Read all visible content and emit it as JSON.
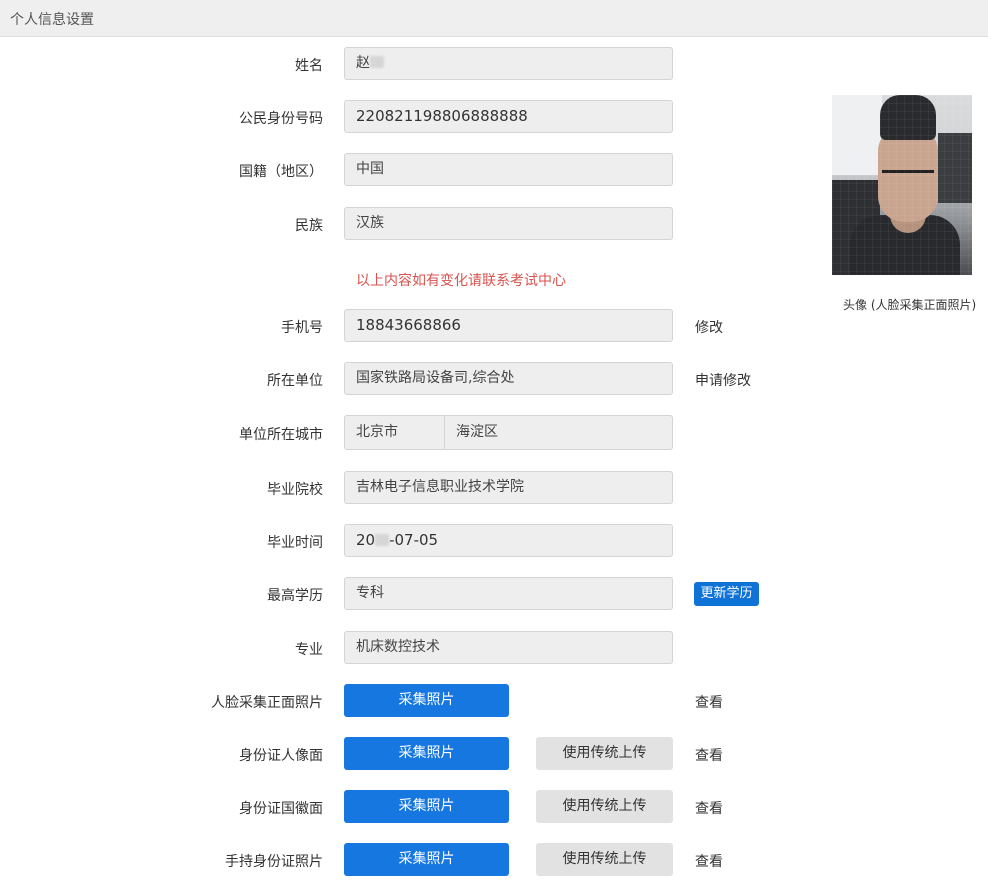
{
  "header": {
    "title": "个人信息设置"
  },
  "form": {
    "name": {
      "label": "姓名",
      "value_prefix": "赵"
    },
    "id_number": {
      "label": "公民身份号码",
      "value": "220821198806888888"
    },
    "nationality": {
      "label": "国籍（地区）",
      "value": "中国"
    },
    "ethnicity": {
      "label": "民族",
      "value": "汉族"
    },
    "notice": "以上内容如有变化请联系考试中心",
    "phone": {
      "label": "手机号",
      "value": "18843668866",
      "action": "修改"
    },
    "employer": {
      "label": "所在单位",
      "value": "国家铁路局设备司,综合处",
      "action": "申请修改"
    },
    "employer_city": {
      "label": "单位所在城市",
      "city": "北京市",
      "district": "海淀区"
    },
    "school": {
      "label": "毕业院校",
      "value": "吉林电子信息职业技术学院"
    },
    "grad_date": {
      "label": "毕业时间",
      "value_prefix": "20",
      "value_suffix": "-07-05"
    },
    "education": {
      "label": "最高学历",
      "value": "专科",
      "action": "更新学历"
    },
    "major": {
      "label": "专业",
      "value": "机床数控技术"
    }
  },
  "photos": {
    "face": {
      "label": "人脸采集正面照片",
      "collect": "采集照片",
      "view": "查看"
    },
    "id_front": {
      "label": "身份证人像面",
      "collect": "采集照片",
      "upload": "使用传统上传",
      "view": "查看"
    },
    "id_back": {
      "label": "身份证国徽面",
      "collect": "采集照片",
      "upload": "使用传统上传",
      "view": "查看"
    },
    "handheld": {
      "label": "手持身份证照片",
      "collect": "采集照片",
      "upload": "使用传统上传",
      "view": "查看"
    }
  },
  "avatar": {
    "caption": "头像 (人脸采集正面照片)"
  },
  "colors": {
    "primary": "#1677e1",
    "notice": "#d9534f",
    "field_bg": "#eeeeee"
  }
}
